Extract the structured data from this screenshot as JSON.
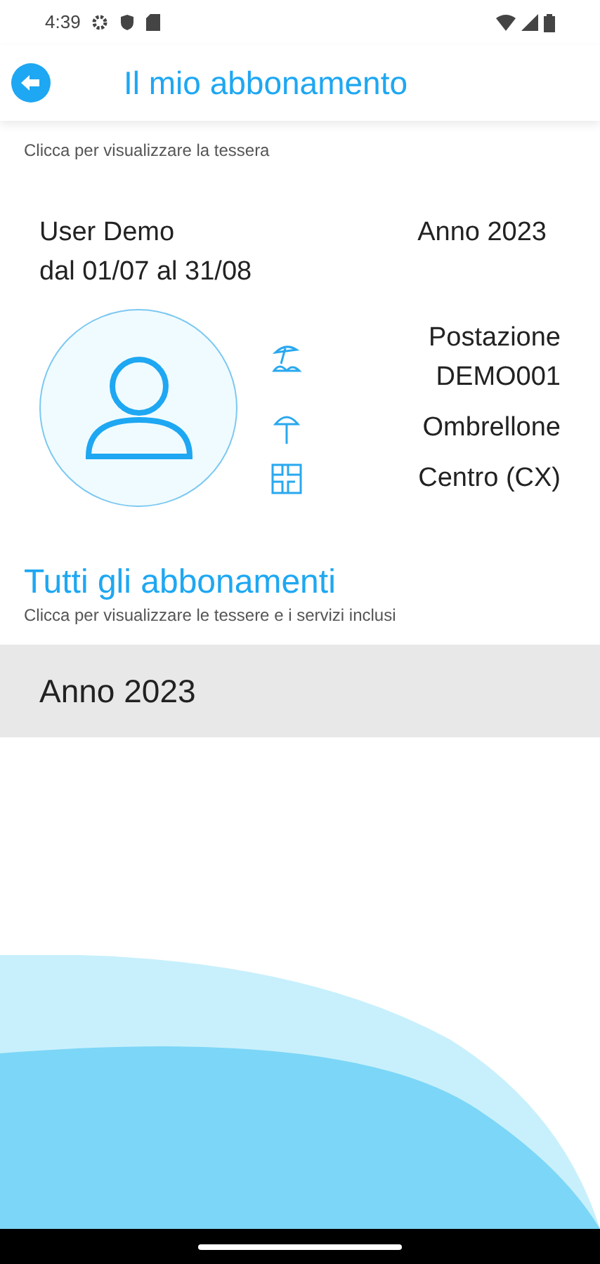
{
  "status_bar": {
    "time": "4:39"
  },
  "header": {
    "title": "Il mio abbonamento"
  },
  "card": {
    "hint": "Clicca per visualizzare la tessera",
    "name": "User Demo",
    "period": "dal 01/07 al 31/08",
    "year": "Anno 2023",
    "details": [
      {
        "kind": "station",
        "text": "Postazione DEMO001"
      },
      {
        "kind": "umbrella",
        "text": "Ombrellone"
      },
      {
        "kind": "zone",
        "text": "Centro (CX)"
      }
    ]
  },
  "all_subscriptions": {
    "title": "Tutti gli abbonamenti",
    "hint": "Clicca per visualizzare le tessere e i servizi inclusi",
    "items": [
      {
        "label": "Anno 2023"
      }
    ]
  }
}
